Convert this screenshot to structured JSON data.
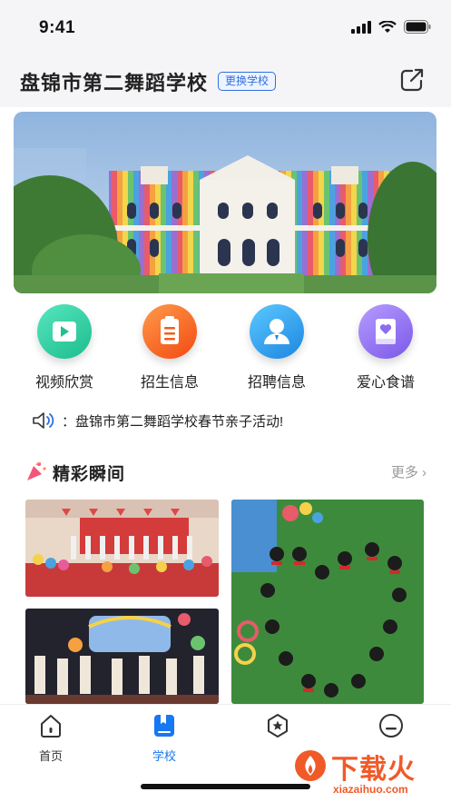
{
  "status_bar": {
    "time": "9:41"
  },
  "header": {
    "school_name": "盘锦市第二舞蹈学校",
    "change_school": "更换学校"
  },
  "quick_nav": [
    {
      "label": "视频欣赏",
      "icon": "play-icon",
      "color": "#2ccfa5"
    },
    {
      "label": "招生信息",
      "icon": "clipboard-icon",
      "color": "#ff6a1f"
    },
    {
      "label": "招聘信息",
      "icon": "person-icon",
      "color": "#2aa6f0"
    },
    {
      "label": "爱心食谱",
      "icon": "heart-book-icon",
      "color": "#8a6cf0"
    }
  ],
  "notice": {
    "text": "：盘锦市第二舞蹈学校春节亲子活动!"
  },
  "section": {
    "title": "精彩瞬间",
    "more": "更多"
  },
  "tab_bar": [
    {
      "label": "首页",
      "icon": "home-icon",
      "active": false
    },
    {
      "label": "学校",
      "icon": "book-icon",
      "active": true
    },
    {
      "label": "",
      "icon": "star-icon",
      "active": false
    },
    {
      "label": "",
      "icon": "profile-icon",
      "active": false
    }
  ],
  "watermark": {
    "text": "下载火",
    "url": "xiazaihuo.com"
  },
  "colors": {
    "accent": "#1877f2",
    "brand_watermark": "#f05a28"
  }
}
